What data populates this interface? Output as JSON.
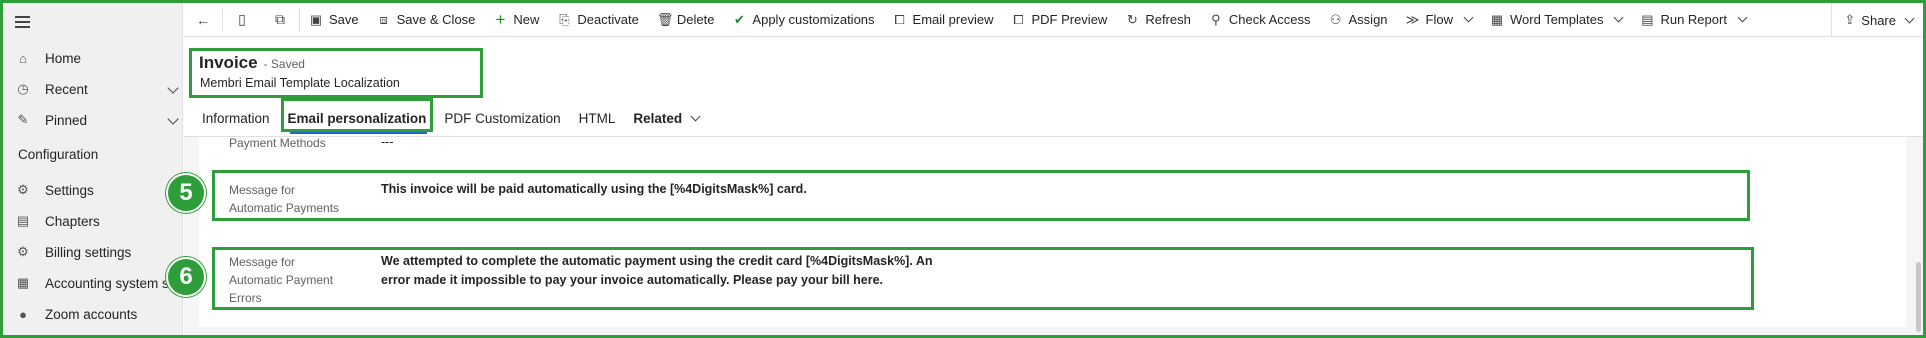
{
  "sidebar": {
    "items": [
      {
        "label": "Home",
        "icon": "home-icon",
        "glyph": "⌂"
      },
      {
        "label": "Recent",
        "icon": "clock-icon",
        "glyph": "◷"
      },
      {
        "label": "Pinned",
        "icon": "pin-icon",
        "glyph": "✎"
      }
    ],
    "section_title": "Configuration",
    "config_items": [
      {
        "label": "Settings",
        "icon": "gear-icon",
        "glyph": "⚙"
      },
      {
        "label": "Chapters",
        "icon": "chapters-icon",
        "glyph": "▤"
      },
      {
        "label": "Billing settings",
        "icon": "billing-icon",
        "glyph": "⚙"
      },
      {
        "label": "Accounting system s...",
        "icon": "accounting-icon",
        "glyph": "▦"
      },
      {
        "label": "Zoom accounts",
        "icon": "zoom-icon",
        "glyph": "●"
      }
    ]
  },
  "toolbar": {
    "save": "Save",
    "save_close": "Save & Close",
    "new": "New",
    "deactivate": "Deactivate",
    "delete": "Delete",
    "apply_customizations": "Apply customizations",
    "email_preview": "Email preview",
    "pdf_preview": "PDF Preview",
    "refresh": "Refresh",
    "check_access": "Check Access",
    "assign": "Assign",
    "flow": "Flow",
    "word_templates": "Word Templates",
    "run_report": "Run Report",
    "share": "Share"
  },
  "header": {
    "title": "Invoice",
    "status": "- Saved",
    "subtitle": "Membri Email Template Localization"
  },
  "tabs": [
    {
      "label": "Information"
    },
    {
      "label": "Email personalization"
    },
    {
      "label": "PDF Customization"
    },
    {
      "label": "HTML"
    },
    {
      "label": "Related"
    }
  ],
  "fields": {
    "payment_methods": {
      "label": "Payment Methods",
      "value": "---"
    },
    "auto_payments": {
      "label_line1": "Message for",
      "label_line2": "Automatic Payments",
      "value": "This invoice will be paid automatically using the [%4DigitsMask%] card."
    },
    "auto_payment_errors": {
      "label_line1": "Message for",
      "label_line2": "Automatic Payment",
      "label_line3": "Errors",
      "value_line1": "We attempted to complete the automatic payment using the credit card  [%4DigitsMask%]. An",
      "value_line2": "error made it impossible to pay your invoice automatically. Please pay your bill here."
    }
  },
  "annotations": {
    "badge_5": "5",
    "badge_6": "6"
  },
  "colors": {
    "highlight": "#2e9e3a",
    "tab_underline": "#2266cc",
    "sidebar_bg": "#f0f0f0"
  }
}
